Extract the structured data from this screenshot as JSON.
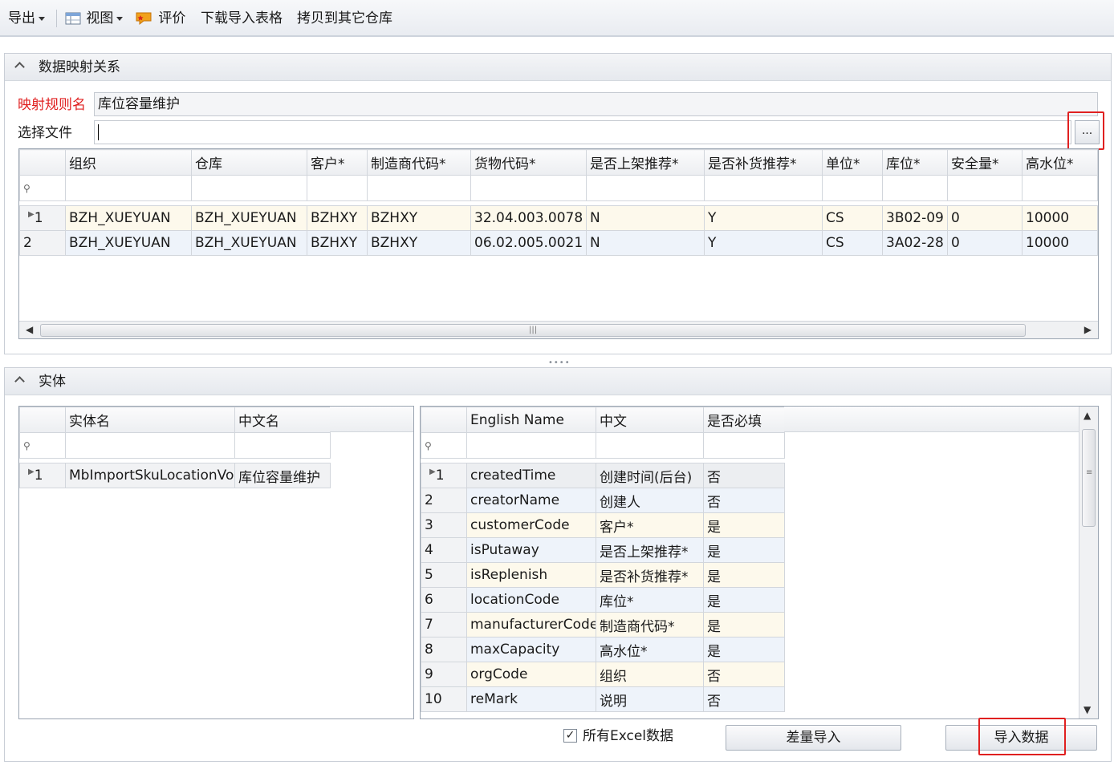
{
  "toolbar": {
    "export_label": "导出",
    "view_label": "视图",
    "rate_label": "评价",
    "download_label": "下载导入表格",
    "copy_label": "拷贝到其它仓库"
  },
  "mapping": {
    "title": "数据映射关系",
    "rule_name_label": "映射规则名",
    "rule_name_value": "库位容量维护",
    "select_file_label": "选择文件",
    "select_file_value": "",
    "browse_label": "...",
    "columns": [
      "组织",
      "仓库",
      "客户*",
      "制造商代码*",
      "货物代码*",
      "是否上架推荐*",
      "是否补货推荐*",
      "单位*",
      "库位*",
      "安全量*",
      "高水位*"
    ],
    "rows": [
      {
        "num": "1",
        "cells": [
          "BZH_XUEYUAN",
          "BZH_XUEYUAN",
          "BZHXY",
          "BZHXY",
          "32.04.003.0078",
          "N",
          "Y",
          "CS",
          "3B02-09",
          "0",
          "10000"
        ]
      },
      {
        "num": "2",
        "cells": [
          "BZH_XUEYUAN",
          "BZH_XUEYUAN",
          "BZHXY",
          "BZHXY",
          "06.02.005.0021",
          "N",
          "Y",
          "CS",
          "3A02-28",
          "0",
          "10000"
        ]
      }
    ]
  },
  "entity": {
    "title": "实体",
    "columns": [
      "实体名",
      "中文名"
    ],
    "rows": [
      {
        "num": "1",
        "cells": [
          "MbImportSkuLocationVo",
          "库位容量维护"
        ]
      }
    ]
  },
  "fields": {
    "columns": [
      "English Name",
      "中文",
      "是否必填"
    ],
    "rows": [
      {
        "num": "1",
        "cells": [
          "createdTime",
          "创建时间(后台)",
          "否"
        ]
      },
      {
        "num": "2",
        "cells": [
          "creatorName",
          "创建人",
          "否"
        ]
      },
      {
        "num": "3",
        "cells": [
          "customerCode",
          "客户*",
          "是"
        ]
      },
      {
        "num": "4",
        "cells": [
          "isPutaway",
          "是否上架推荐*",
          "是"
        ]
      },
      {
        "num": "5",
        "cells": [
          "isReplenish",
          "是否补货推荐*",
          "是"
        ]
      },
      {
        "num": "6",
        "cells": [
          "locationCode",
          "库位*",
          "是"
        ]
      },
      {
        "num": "7",
        "cells": [
          "manufacturerCode",
          "制造商代码*",
          "是"
        ]
      },
      {
        "num": "8",
        "cells": [
          "maxCapacity",
          "高水位*",
          "是"
        ]
      },
      {
        "num": "9",
        "cells": [
          "orgCode",
          "组织",
          "否"
        ]
      },
      {
        "num": "10",
        "cells": [
          "reMark",
          "说明",
          "否"
        ]
      }
    ]
  },
  "footer": {
    "all_excel_label": "所有Excel数据",
    "all_excel_checked": true,
    "diff_import_label": "差量导入",
    "import_label": "导入数据"
  },
  "colors": {
    "required_label": "#e02020",
    "highlight_box": "#e02020",
    "odd_row": "#fdf9ec",
    "even_row": "#eef3fa"
  }
}
